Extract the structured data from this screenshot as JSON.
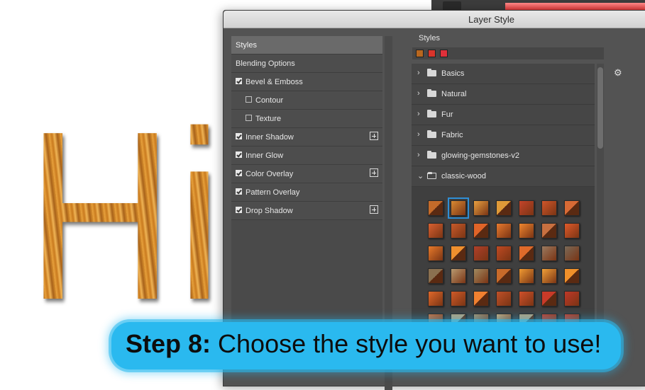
{
  "dialog": {
    "title": "Layer Style"
  },
  "artwork": {
    "text": "Hi"
  },
  "left_list": [
    {
      "label": "Styles",
      "checkbox": null,
      "selected": true,
      "indent": false,
      "plus": false
    },
    {
      "label": "Blending Options",
      "checkbox": null,
      "selected": false,
      "indent": false,
      "plus": false
    },
    {
      "label": "Bevel & Emboss",
      "checkbox": true,
      "selected": false,
      "indent": false,
      "plus": false
    },
    {
      "label": "Contour",
      "checkbox": false,
      "selected": false,
      "indent": true,
      "plus": false
    },
    {
      "label": "Texture",
      "checkbox": false,
      "selected": false,
      "indent": true,
      "plus": false
    },
    {
      "label": "Inner Shadow",
      "checkbox": true,
      "selected": false,
      "indent": false,
      "plus": true
    },
    {
      "label": "Inner Glow",
      "checkbox": true,
      "selected": false,
      "indent": false,
      "plus": false
    },
    {
      "label": "Color Overlay",
      "checkbox": true,
      "selected": false,
      "indent": false,
      "plus": true
    },
    {
      "label": "Pattern Overlay",
      "checkbox": true,
      "selected": false,
      "indent": false,
      "plus": false
    },
    {
      "label": "Drop Shadow",
      "checkbox": true,
      "selected": false,
      "indent": false,
      "plus": true
    }
  ],
  "styles_panel": {
    "label": "Styles",
    "mini_swatches": [
      "#b8671f",
      "#d9342b",
      "#e0303a"
    ],
    "folders": [
      {
        "name": "Basics",
        "open": false
      },
      {
        "name": "Natural",
        "open": false
      },
      {
        "name": "Fur",
        "open": false
      },
      {
        "name": "Fabric",
        "open": false
      },
      {
        "name": "glowing-gemstones-v2",
        "open": false
      },
      {
        "name": "classic-wood",
        "open": true
      }
    ],
    "settings_icon": "gear-icon",
    "selected_swatch_index": 1,
    "swatch_rows": [
      [
        "#c46b2a",
        "#d98a32",
        "#e8a040",
        "#e09a38",
        "#c4442a",
        "#d0562a",
        "#d86a35"
      ],
      [
        "#d86030",
        "#c85a2a",
        "#e06428",
        "#e87a2e",
        "#f0862e",
        "#c87040",
        "#e05a2a"
      ],
      [
        "#e87a2a",
        "#f0902e",
        "#b0402a",
        "#c04a22",
        "#e06a2a",
        "#9a7a60",
        "#7a6a58"
      ],
      [
        "#8a7050",
        "#b89a70",
        "#a08a60",
        "#c86a2a",
        "#f09a32",
        "#f0a038",
        "#f0902a"
      ],
      [
        "#e0682a",
        "#d05a28",
        "#f08030",
        "#c05028",
        "#d0502a",
        "#c83a28",
        "#c03828"
      ],
      [
        "#c87040",
        "#b0a080",
        "#a09070",
        "#c8a878",
        "#b0a080",
        "#c04030",
        "#c04030"
      ]
    ]
  },
  "caption": {
    "bold": "Step 8:",
    "rest": " Choose the style you want to use!"
  }
}
